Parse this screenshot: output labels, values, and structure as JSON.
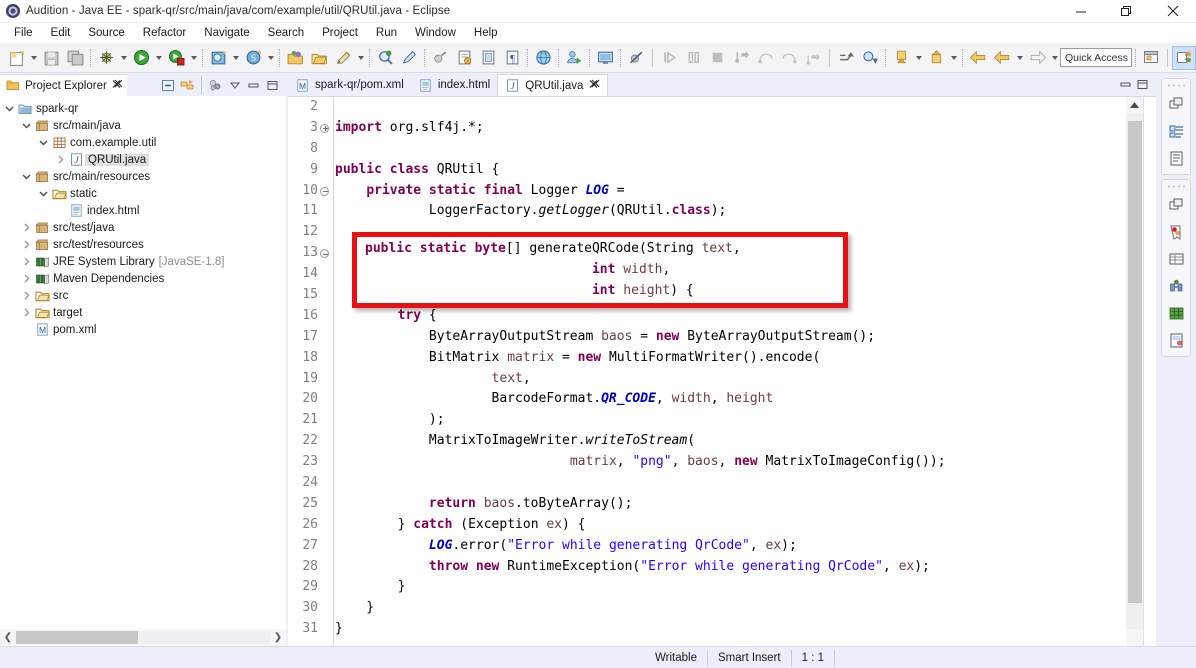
{
  "window": {
    "title": "Audition - Java EE - spark-qr/src/main/java/com/example/util/QRUtil.java - Eclipse",
    "app_icon": "eclipse-icon",
    "controls": {
      "minimize": "minimize-button",
      "restore": "restore-button",
      "close": "close-button"
    }
  },
  "menubar": {
    "items": [
      "File",
      "Edit",
      "Source",
      "Refactor",
      "Navigate",
      "Search",
      "Project",
      "Run",
      "Window",
      "Help"
    ]
  },
  "toolbar": {
    "quick_access_placeholder": "Quick Access",
    "groups": [
      {
        "buttons": [
          {
            "name": "new-wizard-icon",
            "arrow": true
          },
          {
            "name": "save-icon",
            "arrow": false
          },
          {
            "name": "save-all-icon",
            "arrow": false
          }
        ]
      },
      {
        "buttons": [
          {
            "name": "debug-icon",
            "arrow": true
          },
          {
            "name": "run-icon",
            "arrow": true
          },
          {
            "name": "coverage-icon",
            "arrow": true
          }
        ]
      },
      {
        "buttons": [
          {
            "name": "new-java-project-icon",
            "arrow": true
          },
          {
            "name": "new-servlet-icon",
            "arrow": true
          }
        ]
      },
      {
        "buttons": [
          {
            "name": "open-type-icon",
            "arrow": false
          },
          {
            "name": "open-resource-icon",
            "arrow": false
          },
          {
            "name": "edit-icon",
            "arrow": true
          }
        ]
      },
      {
        "buttons": [
          {
            "name": "search-icon",
            "arrow": false
          },
          {
            "name": "marker-icon",
            "arrow": false
          }
        ]
      },
      {
        "buttons": [
          {
            "name": "annotation-icon",
            "arrow": false
          },
          {
            "name": "new-jsp-icon",
            "arrow": false
          },
          {
            "name": "book-icon",
            "arrow": false
          },
          {
            "name": "paragraph-icon",
            "arrow": false
          }
        ]
      },
      {
        "buttons": [
          {
            "name": "web-browser-icon",
            "arrow": false
          }
        ]
      },
      {
        "buttons": [
          {
            "name": "new-server-icon",
            "arrow": false
          }
        ]
      },
      {
        "buttons": [
          {
            "name": "console-icon",
            "arrow": false
          }
        ]
      },
      {
        "buttons": [
          {
            "name": "skip-breakpoints-icon",
            "arrow": false
          }
        ]
      },
      {
        "buttons": [
          {
            "name": "resume-icon",
            "arrow": false
          },
          {
            "name": "suspend-icon",
            "arrow": false
          },
          {
            "name": "terminate-icon",
            "arrow": false
          },
          {
            "name": "step-into-icon",
            "arrow": false
          },
          {
            "name": "step-over-icon",
            "arrow": false
          },
          {
            "name": "step-return-icon",
            "arrow": false
          },
          {
            "name": "drop-to-frame-icon",
            "arrow": false
          }
        ]
      },
      {
        "buttons": [
          {
            "name": "previous-annotation-icon",
            "arrow": false
          },
          {
            "name": "next-annotation-icon",
            "arrow": false
          }
        ]
      },
      {
        "buttons": [
          {
            "name": "next-edit-icon",
            "arrow": true
          },
          {
            "name": "previous-edit-icon",
            "arrow": true
          }
        ]
      },
      {
        "buttons": [
          {
            "name": "back-history-icon",
            "arrow": false
          },
          {
            "name": "back-icon",
            "arrow": true
          },
          {
            "name": "forward-icon",
            "arrow": true
          }
        ]
      }
    ],
    "perspective_buttons": [
      {
        "name": "open-perspective-icon",
        "active": false
      },
      {
        "name": "java-ee-perspective-icon",
        "active": true
      }
    ]
  },
  "explorer": {
    "tab_label": "Project Explorer",
    "tab_icon": "project-explorer-icon",
    "tab_close": "close-icon",
    "tools": [
      "collapse-all-icon",
      "link-with-editor-icon",
      "focus-icon",
      "view-menu-icon",
      "minimize-icon",
      "maximize-icon"
    ],
    "tree": [
      {
        "label": "spark-qr",
        "depth": 0,
        "twisty": "down",
        "icon": "project-icon",
        "selected": false,
        "sub": ""
      },
      {
        "label": "src/main/java",
        "depth": 1,
        "twisty": "down",
        "icon": "package-root-icon",
        "selected": false,
        "sub": ""
      },
      {
        "label": "com.example.util",
        "depth": 2,
        "twisty": "down",
        "icon": "package-icon",
        "selected": false,
        "sub": ""
      },
      {
        "label": "QRUtil.java",
        "depth": 3,
        "twisty": "right",
        "icon": "java-file-icon",
        "selected": true,
        "sub": ""
      },
      {
        "label": "src/main/resources",
        "depth": 1,
        "twisty": "down",
        "icon": "package-root-icon",
        "selected": false,
        "sub": ""
      },
      {
        "label": "static",
        "depth": 2,
        "twisty": "down",
        "icon": "folder-icon",
        "selected": false,
        "sub": ""
      },
      {
        "label": "index.html",
        "depth": 3,
        "twisty": "none",
        "icon": "html-file-icon",
        "selected": false,
        "sub": ""
      },
      {
        "label": "src/test/java",
        "depth": 1,
        "twisty": "right",
        "icon": "package-root-icon",
        "selected": false,
        "sub": ""
      },
      {
        "label": "src/test/resources",
        "depth": 1,
        "twisty": "right",
        "icon": "package-root-icon",
        "selected": false,
        "sub": ""
      },
      {
        "label": "JRE System Library",
        "depth": 1,
        "twisty": "right",
        "icon": "library-icon",
        "selected": false,
        "sub": "[JavaSE-1.8]"
      },
      {
        "label": "Maven Dependencies",
        "depth": 1,
        "twisty": "right",
        "icon": "library-icon",
        "selected": false,
        "sub": ""
      },
      {
        "label": "src",
        "depth": 1,
        "twisty": "right",
        "icon": "folder-icon",
        "selected": false,
        "sub": ""
      },
      {
        "label": "target",
        "depth": 1,
        "twisty": "right",
        "icon": "folder-icon",
        "selected": false,
        "sub": ""
      },
      {
        "label": "pom.xml",
        "depth": 1,
        "twisty": "none",
        "icon": "maven-file-icon",
        "selected": false,
        "sub": ""
      }
    ]
  },
  "editor": {
    "tabs": [
      {
        "label": "spark-qr/pom.xml",
        "icon": "maven-file-icon",
        "active": false,
        "closable": false
      },
      {
        "label": "index.html",
        "icon": "html-file-icon",
        "active": false,
        "closable": false
      },
      {
        "label": "QRUtil.java",
        "icon": "java-file-icon",
        "active": true,
        "closable": true
      }
    ],
    "tools": [
      "minimize-icon",
      "maximize-icon"
    ],
    "gutter": [
      {
        "num": "2",
        "fold": "none"
      },
      {
        "num": "3",
        "fold": "plus"
      },
      {
        "num": "8",
        "fold": "none"
      },
      {
        "num": "9",
        "fold": "none"
      },
      {
        "num": "10",
        "fold": "minus"
      },
      {
        "num": "11",
        "fold": "none"
      },
      {
        "num": "12",
        "fold": "none"
      },
      {
        "num": "13",
        "fold": "minus"
      },
      {
        "num": "14",
        "fold": "none"
      },
      {
        "num": "15",
        "fold": "none"
      },
      {
        "num": "16",
        "fold": "none"
      },
      {
        "num": "17",
        "fold": "none"
      },
      {
        "num": "18",
        "fold": "none"
      },
      {
        "num": "19",
        "fold": "none"
      },
      {
        "num": "20",
        "fold": "none"
      },
      {
        "num": "21",
        "fold": "none"
      },
      {
        "num": "22",
        "fold": "none"
      },
      {
        "num": "23",
        "fold": "none"
      },
      {
        "num": "24",
        "fold": "none"
      },
      {
        "num": "25",
        "fold": "none"
      },
      {
        "num": "26",
        "fold": "none"
      },
      {
        "num": "27",
        "fold": "none"
      },
      {
        "num": "28",
        "fold": "none"
      },
      {
        "num": "29",
        "fold": "none"
      },
      {
        "num": "30",
        "fold": "none"
      },
      {
        "num": "31",
        "fold": "none"
      }
    ],
    "code_lines": [
      [],
      [
        {
          "t": "import",
          "c": "kw"
        },
        {
          "t": " org.slf4j.*;",
          "c": "pl"
        }
      ],
      [],
      [
        {
          "t": "public class",
          "c": "kw"
        },
        {
          "t": " QRUtil {",
          "c": "pl"
        }
      ],
      [
        {
          "t": "    ",
          "c": "pl"
        },
        {
          "t": "private static final",
          "c": "kw"
        },
        {
          "t": " Logger ",
          "c": "pl"
        },
        {
          "t": "LOG",
          "c": "fld"
        },
        {
          "t": " =",
          "c": "pl"
        }
      ],
      [
        {
          "t": "            LoggerFactory.",
          "c": "pl"
        },
        {
          "t": "getLogger",
          "c": "mth"
        },
        {
          "t": "(QRUtil.",
          "c": "pl"
        },
        {
          "t": "class",
          "c": "kw"
        },
        {
          "t": ");",
          "c": "pl"
        }
      ],
      [],
      [
        {
          "t": "    ",
          "c": "pl"
        },
        {
          "t": "public static byte",
          "c": "kw"
        },
        {
          "t": "[] generateQRCode(String ",
          "c": "pl"
        },
        {
          "t": "text",
          "c": "var"
        },
        {
          "t": ",",
          "c": "pl"
        }
      ],
      [
        {
          "t": "                                 ",
          "c": "pl"
        },
        {
          "t": "int",
          "c": "kw"
        },
        {
          "t": " ",
          "c": "pl"
        },
        {
          "t": "width",
          "c": "var"
        },
        {
          "t": ",",
          "c": "pl"
        }
      ],
      [
        {
          "t": "                                 ",
          "c": "pl"
        },
        {
          "t": "int",
          "c": "kw"
        },
        {
          "t": " ",
          "c": "pl"
        },
        {
          "t": "height",
          "c": "var"
        },
        {
          "t": ") {",
          "c": "pl"
        }
      ],
      [
        {
          "t": "        ",
          "c": "pl"
        },
        {
          "t": "try",
          "c": "kw"
        },
        {
          "t": " {",
          "c": "pl"
        }
      ],
      [
        {
          "t": "            ByteArrayOutputStream ",
          "c": "pl"
        },
        {
          "t": "baos",
          "c": "var"
        },
        {
          "t": " = ",
          "c": "pl"
        },
        {
          "t": "new",
          "c": "kw"
        },
        {
          "t": " ByteArrayOutputStream();",
          "c": "pl"
        }
      ],
      [
        {
          "t": "            BitMatrix ",
          "c": "pl"
        },
        {
          "t": "matrix",
          "c": "var"
        },
        {
          "t": " = ",
          "c": "pl"
        },
        {
          "t": "new",
          "c": "kw"
        },
        {
          "t": " MultiFormatWriter().encode(",
          "c": "pl"
        }
      ],
      [
        {
          "t": "                    ",
          "c": "pl"
        },
        {
          "t": "text",
          "c": "var"
        },
        {
          "t": ",",
          "c": "pl"
        }
      ],
      [
        {
          "t": "                    BarcodeFormat.",
          "c": "pl"
        },
        {
          "t": "QR_CODE",
          "c": "fld"
        },
        {
          "t": ", ",
          "c": "pl"
        },
        {
          "t": "width",
          "c": "var"
        },
        {
          "t": ", ",
          "c": "pl"
        },
        {
          "t": "height",
          "c": "var"
        }
      ],
      [
        {
          "t": "            );",
          "c": "pl"
        }
      ],
      [
        {
          "t": "            MatrixToImageWriter.",
          "c": "pl"
        },
        {
          "t": "writeToStream",
          "c": "mth"
        },
        {
          "t": "(",
          "c": "pl"
        }
      ],
      [
        {
          "t": "                              ",
          "c": "pl"
        },
        {
          "t": "matrix",
          "c": "var"
        },
        {
          "t": ", ",
          "c": "pl"
        },
        {
          "t": "\"png\"",
          "c": "str"
        },
        {
          "t": ", ",
          "c": "pl"
        },
        {
          "t": "baos",
          "c": "var"
        },
        {
          "t": ", ",
          "c": "pl"
        },
        {
          "t": "new",
          "c": "kw"
        },
        {
          "t": " MatrixToImageConfig());",
          "c": "pl"
        }
      ],
      [],
      [
        {
          "t": "            ",
          "c": "pl"
        },
        {
          "t": "return",
          "c": "kw"
        },
        {
          "t": " ",
          "c": "pl"
        },
        {
          "t": "baos",
          "c": "var"
        },
        {
          "t": ".toByteArray();",
          "c": "pl"
        }
      ],
      [
        {
          "t": "        } ",
          "c": "pl"
        },
        {
          "t": "catch",
          "c": "kw"
        },
        {
          "t": " (Exception ",
          "c": "pl"
        },
        {
          "t": "ex",
          "c": "var"
        },
        {
          "t": ") {",
          "c": "pl"
        }
      ],
      [
        {
          "t": "            ",
          "c": "pl"
        },
        {
          "t": "LOG",
          "c": "fld"
        },
        {
          "t": ".error(",
          "c": "pl"
        },
        {
          "t": "\"Error while generating QrCode\"",
          "c": "str"
        },
        {
          "t": ", ",
          "c": "pl"
        },
        {
          "t": "ex",
          "c": "var"
        },
        {
          "t": ");",
          "c": "pl"
        }
      ],
      [
        {
          "t": "            ",
          "c": "pl"
        },
        {
          "t": "throw new",
          "c": "kw"
        },
        {
          "t": " RuntimeException(",
          "c": "pl"
        },
        {
          "t": "\"Error while generating QrCode\"",
          "c": "str"
        },
        {
          "t": ", ",
          "c": "pl"
        },
        {
          "t": "ex",
          "c": "var"
        },
        {
          "t": ");",
          "c": "pl"
        }
      ],
      [
        {
          "t": "        }",
          "c": "pl"
        }
      ],
      [
        {
          "t": "    }",
          "c": "pl"
        }
      ],
      [
        {
          "t": "}",
          "c": "pl"
        }
      ]
    ],
    "highlight_box": {
      "color": "#e81010",
      "lines": [
        [
          {
            "t": "public static byte",
            "c": "kw"
          },
          {
            "t": "[] generateQRCode(String ",
            "c": "pl"
          },
          {
            "t": "text",
            "c": "var"
          },
          {
            "t": ",",
            "c": "pl"
          }
        ],
        [
          {
            "t": "                             ",
            "c": "pl"
          },
          {
            "t": "int",
            "c": "kw"
          },
          {
            "t": " ",
            "c": "pl"
          },
          {
            "t": "width",
            "c": "var"
          },
          {
            "t": ",",
            "c": "pl"
          }
        ],
        [
          {
            "t": "                             ",
            "c": "pl"
          },
          {
            "t": "int",
            "c": "kw"
          },
          {
            "t": " ",
            "c": "pl"
          },
          {
            "t": "height",
            "c": "var"
          },
          {
            "t": ") {",
            "c": "pl"
          }
        ]
      ]
    }
  },
  "rail": {
    "groups": [
      {
        "buttons": [
          {
            "name": "restore-views-icon",
            "active": false
          },
          {
            "name": "outline-view-icon",
            "active": false
          },
          {
            "name": "task-list-icon",
            "active": false
          }
        ]
      },
      {
        "buttons": [
          {
            "name": "restore-views-icon",
            "active": false
          },
          {
            "name": "markers-view-icon",
            "active": false
          },
          {
            "name": "properties-view-icon",
            "active": false
          },
          {
            "name": "servers-view-icon",
            "active": false
          },
          {
            "name": "data-source-icon",
            "active": false
          },
          {
            "name": "snippets-view-icon",
            "active": false
          }
        ]
      }
    ]
  },
  "statusbar": {
    "writable": "Writable",
    "insert_mode": "Smart Insert",
    "position": "1 : 1"
  }
}
